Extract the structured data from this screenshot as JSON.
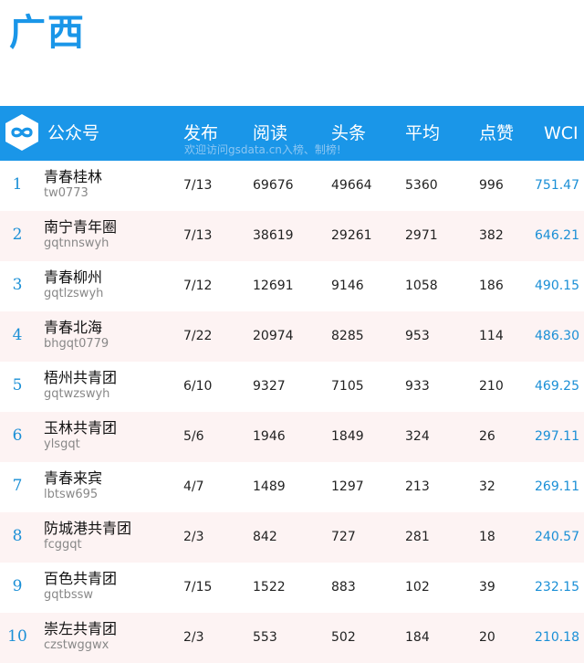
{
  "page": {
    "title": "广西"
  },
  "header": {
    "account": "公众号",
    "publish": "发布",
    "read": "阅读",
    "headline": "头条",
    "average": "平均",
    "likes": "点赞",
    "wci": "WCI",
    "subtitle": "欢迎访问gsdata.cn入榜、制榜!"
  },
  "colors": {
    "accent": "#1a96e8",
    "alt_row": "#fdf3f3",
    "rank": "#1a8fd6"
  },
  "icons": {
    "logo": "infinity-logo-icon"
  },
  "rows": [
    {
      "rank": "1",
      "name": "青春桂林",
      "account": "tw0773",
      "publish": "7/13",
      "read": "69676",
      "headline": "49664",
      "average": "5360",
      "likes": "996",
      "wci": "751.47"
    },
    {
      "rank": "2",
      "name": "南宁青年圈",
      "account": "gqtnnswyh",
      "publish": "7/13",
      "read": "38619",
      "headline": "29261",
      "average": "2971",
      "likes": "382",
      "wci": "646.21"
    },
    {
      "rank": "3",
      "name": "青春柳州",
      "account": "gqtlzswyh",
      "publish": "7/12",
      "read": "12691",
      "headline": "9146",
      "average": "1058",
      "likes": "186",
      "wci": "490.15"
    },
    {
      "rank": "4",
      "name": "青春北海",
      "account": "bhgqt0779",
      "publish": "7/22",
      "read": "20974",
      "headline": "8285",
      "average": "953",
      "likes": "114",
      "wci": "486.30"
    },
    {
      "rank": "5",
      "name": "梧州共青团",
      "account": "gqtwzswyh",
      "publish": "6/10",
      "read": "9327",
      "headline": "7105",
      "average": "933",
      "likes": "210",
      "wci": "469.25"
    },
    {
      "rank": "6",
      "name": "玉林共青团",
      "account": "ylsgqt",
      "publish": "5/6",
      "read": "1946",
      "headline": "1849",
      "average": "324",
      "likes": "26",
      "wci": "297.11"
    },
    {
      "rank": "7",
      "name": "青春来宾",
      "account": "lbtsw695",
      "publish": "4/7",
      "read": "1489",
      "headline": "1297",
      "average": "213",
      "likes": "32",
      "wci": "269.11"
    },
    {
      "rank": "8",
      "name": "防城港共青团",
      "account": "fcggqt",
      "publish": "2/3",
      "read": "842",
      "headline": "727",
      "average": "281",
      "likes": "18",
      "wci": "240.57"
    },
    {
      "rank": "9",
      "name": "百色共青团",
      "account": "gqtbssw",
      "publish": "7/15",
      "read": "1522",
      "headline": "883",
      "average": "102",
      "likes": "39",
      "wci": "232.15"
    },
    {
      "rank": "10",
      "name": "崇左共青团",
      "account": "czstwggwx",
      "publish": "2/3",
      "read": "553",
      "headline": "502",
      "average": "184",
      "likes": "20",
      "wci": "210.18"
    }
  ]
}
